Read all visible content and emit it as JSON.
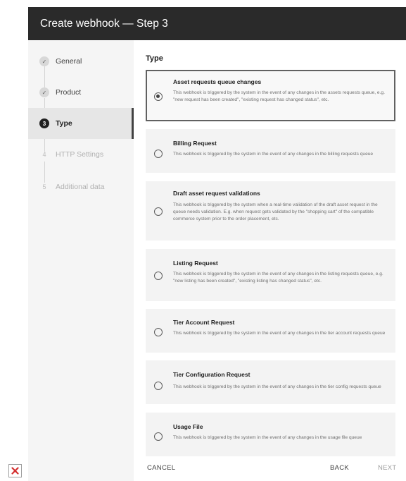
{
  "dialog": {
    "title": "Create webhook — Step 3"
  },
  "steps": [
    {
      "label": "General",
      "state": "done",
      "marker": "✓"
    },
    {
      "label": "Product",
      "state": "done",
      "marker": "✓"
    },
    {
      "label": "Type",
      "state": "active",
      "marker": "3"
    },
    {
      "label": "HTTP Settings",
      "state": "todo",
      "marker": "4"
    },
    {
      "label": "Additional data",
      "state": "todo",
      "marker": "5"
    }
  ],
  "section": {
    "title": "Type"
  },
  "options": [
    {
      "title": "Asset requests queue changes",
      "description": "This webhook is triggered by the system in the event of any changes in the assets requests queue, e.g. \"new request has been created\", \"existing request has changed status\", etc.",
      "selected": true
    },
    {
      "title": "Billing Request",
      "description": "This webhook is triggered by the system in the event of any changes in the billing requests queue",
      "selected": false
    },
    {
      "title": "Draft asset request validations",
      "description": "This webhook is triggered by the system when a real-time validation of the draft asset request in the queue needs validation. E.g. when request gets validated by the \"shopping cart\" of the compatible commerce system prior to the order placement, etc.",
      "selected": false
    },
    {
      "title": "Listing Request",
      "description": "This webhook is triggered by the system in the event of any changes in the listing requests queue, e.g. \"new listing has been created\", \"existing listing has changed status\", etc.",
      "selected": false
    },
    {
      "title": "Tier Account Request",
      "description": "This webhook is triggered by the system in the event of any changes in the tier account requests queue",
      "selected": false
    },
    {
      "title": "Tier Configuration Request",
      "description": "This webhook is triggered by the system in the event of any changes in the tier config requests queue",
      "selected": false
    },
    {
      "title": "Usage File",
      "description": "This webhook is triggered by the system in the event of any changes in the usage file queue",
      "selected": false
    }
  ],
  "footer": {
    "cancel_label": "CANCEL",
    "back_label": "BACK",
    "next_label": "NEXT"
  },
  "colors": {
    "titlebar": "#2a2a2a",
    "active_step_bg": "#e6e6e6",
    "card_bg": "#f3f3f3",
    "selected_border": "#616161"
  }
}
